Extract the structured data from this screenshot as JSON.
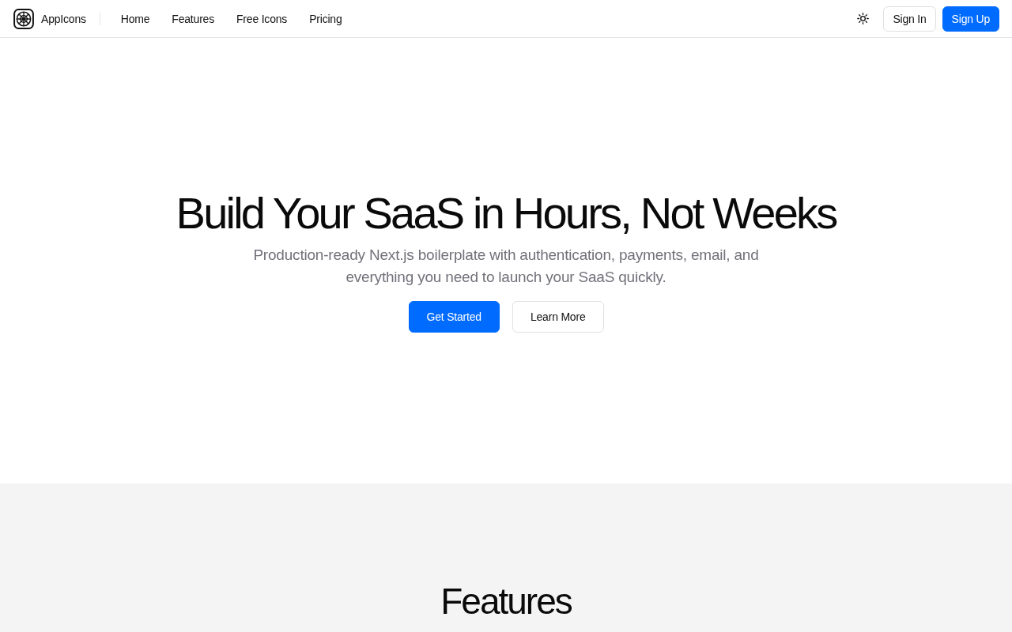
{
  "header": {
    "brand": "AppIcons",
    "nav": [
      {
        "label": "Home"
      },
      {
        "label": "Features"
      },
      {
        "label": "Free Icons"
      },
      {
        "label": "Pricing"
      }
    ],
    "actions": [
      {
        "label": "Sign In",
        "kind": "secondary"
      },
      {
        "label": "Sign Up",
        "kind": "primary"
      }
    ]
  },
  "hero": {
    "title": "Build Your SaaS in Hours, Not Weeks",
    "subtitle": "Production-ready Next.js boilerplate with authentication, payments, email, and everything you need to launch your SaaS quickly.",
    "buttons": [
      {
        "label": "Get Started",
        "kind": "primary"
      },
      {
        "label": "Learn More",
        "kind": "secondary"
      }
    ]
  },
  "features": {
    "heading": "Features"
  }
}
